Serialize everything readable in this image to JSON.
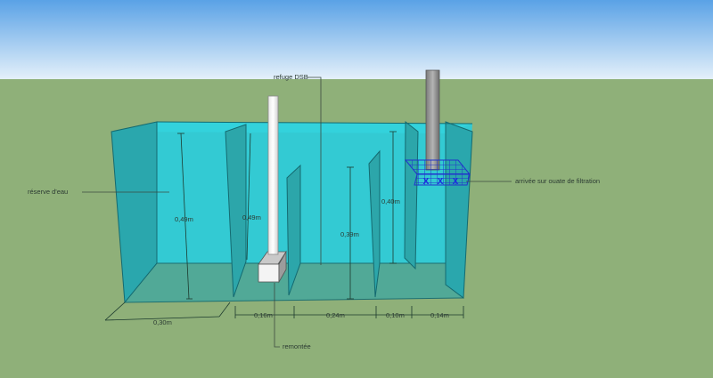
{
  "colors": {
    "sky_top": "#5aa2e6",
    "sky_bottom": "#e4f0fa",
    "ground": "#8fb079",
    "water": "#2ecbd8",
    "glass": "#2aa7ad",
    "pipe": "#9a9a9a",
    "grid": "#2233cc"
  },
  "labels": {
    "refuge": "refuge DSB",
    "reserve": "réserve d'eau",
    "arrivee": "arrivée sur ouate de filtration",
    "remontee": "remontée"
  },
  "dimensions": {
    "h_reserve": "0,49m",
    "h_mid": "0,49m",
    "h_refuge": "0,39m",
    "h_filter": "0,40m",
    "w_reserve": "0,30m",
    "w_pump": "0,16m",
    "w_refuge": "0,24m",
    "w_gap": "0,10m",
    "w_filter": "0,14m"
  },
  "markers": [
    "X",
    "X",
    "X"
  ]
}
